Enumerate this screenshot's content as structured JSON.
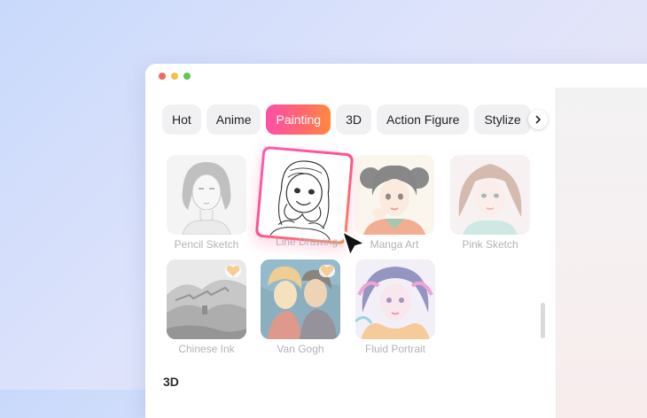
{
  "tabs": [
    {
      "label": "Hot",
      "active": false
    },
    {
      "label": "Anime",
      "active": false
    },
    {
      "label": "Painting",
      "active": true
    },
    {
      "label": "3D",
      "active": false
    },
    {
      "label": "Action Figure",
      "active": false
    },
    {
      "label": "Stylize",
      "active": false
    }
  ],
  "styles": [
    {
      "label": "Pencil Sketch"
    },
    {
      "label": "Line Drawing",
      "selected": true
    },
    {
      "label": "Manga Art"
    },
    {
      "label": "Pink Sketch"
    },
    {
      "label": "Chinese Ink",
      "badge": "heart-icon"
    },
    {
      "label": "Van Gogh",
      "badge": "heart-icon"
    },
    {
      "label": "Fluid Portrait"
    }
  ],
  "next_section": "3D",
  "colors": {
    "active_tab_gradient": [
      "#ff4fa6",
      "#ff8a3d"
    ],
    "window_dots": [
      "#ee6a5f",
      "#f5be4f",
      "#62c554"
    ]
  }
}
